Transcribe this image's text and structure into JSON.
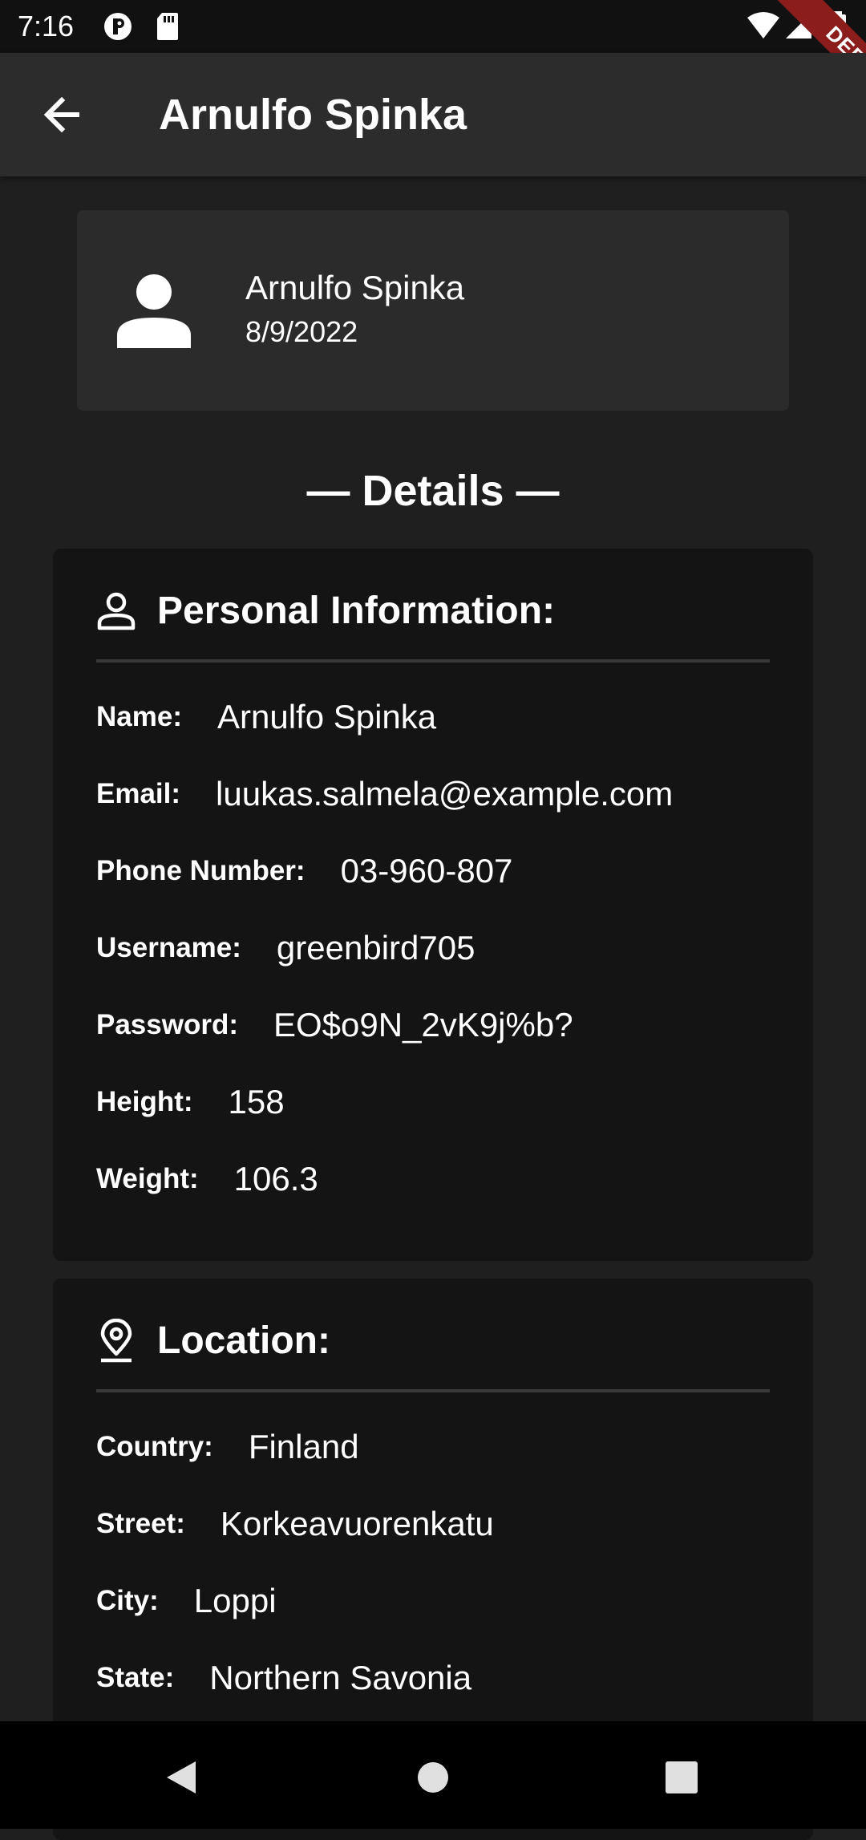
{
  "status_bar": {
    "time": "7:16",
    "icons": [
      "app-notification-icon",
      "sd-card-icon",
      "wifi-icon",
      "cell-signal-icon",
      "battery-icon"
    ],
    "debug_label": "DEBUG"
  },
  "app_bar": {
    "title": "Arnulfo Spinka",
    "back_icon": "arrow-back-icon"
  },
  "profile": {
    "name": "Arnulfo Spinka",
    "date": "8/9/2022",
    "avatar_icon": "person-icon"
  },
  "details_heading": "— Details —",
  "personal": {
    "title": "Personal Information:",
    "icon": "person-outline-icon",
    "fields": [
      {
        "label": "Name:",
        "value": "Arnulfo Spinka"
      },
      {
        "label": "Email:",
        "value": "luukas.salmela@example.com"
      },
      {
        "label": "Phone Number:",
        "value": "03-960-807"
      },
      {
        "label": "Username:",
        "value": "greenbird705"
      },
      {
        "label": "Password:",
        "value": "EO$o9N_2vK9j%b?"
      },
      {
        "label": "Height:",
        "value": "158"
      },
      {
        "label": "Weight:",
        "value": "106.3"
      }
    ]
  },
  "location": {
    "title": "Location:",
    "icon": "location-pin-icon",
    "fields": [
      {
        "label": "Country:",
        "value": "Finland"
      },
      {
        "label": "Street:",
        "value": "Korkeavuorenkatu"
      },
      {
        "label": "City:",
        "value": "Loppi"
      },
      {
        "label": "State:",
        "value": "Northern Savonia"
      }
    ]
  },
  "nav_bar": {
    "buttons": [
      "back-triangle-icon",
      "home-circle-icon",
      "recents-square-icon"
    ]
  },
  "colors": {
    "background": "#1f1f1f",
    "app_bar": "#2c2c2c",
    "card": "#2b2b2b",
    "section": "#141414",
    "debug_ribbon": "#8b1d1d"
  }
}
